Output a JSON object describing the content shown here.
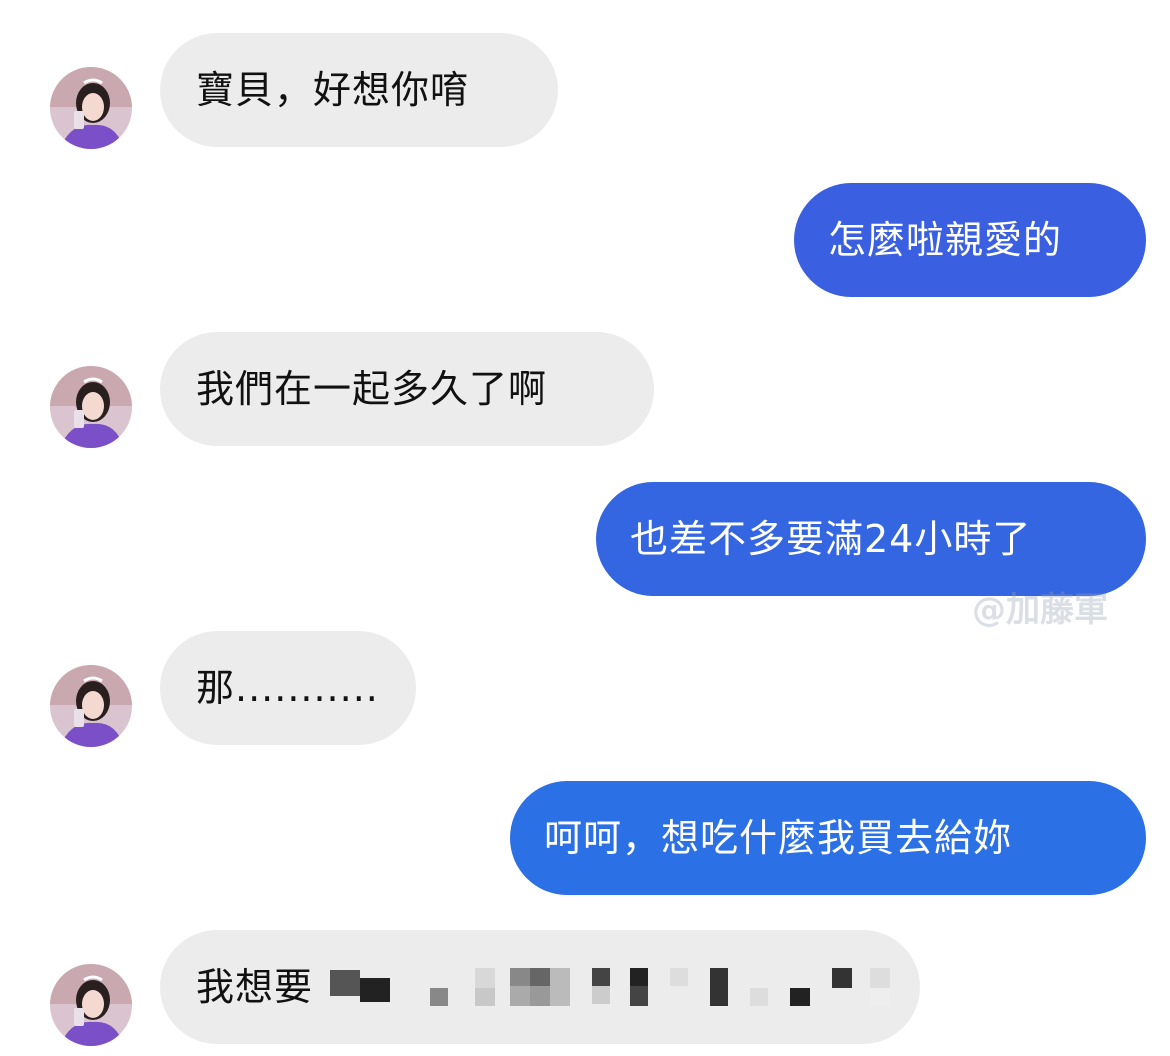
{
  "conversation": {
    "messages": [
      {
        "side": "incoming",
        "text": "寶貝，好想你唷"
      },
      {
        "side": "outgoing",
        "text": "怎麼啦親愛的"
      },
      {
        "side": "incoming",
        "text": "我們在一起多久了啊"
      },
      {
        "side": "outgoing",
        "text": "也差不多要滿24小時了"
      },
      {
        "side": "incoming",
        "text": "那..........."
      },
      {
        "side": "outgoing",
        "text": "呵呵，想吃什麼我買去給妳"
      },
      {
        "side": "incoming",
        "text": "我想要"
      }
    ]
  },
  "watermark": "@加藤軍",
  "colors": {
    "incoming_bubble": "#ececec",
    "outgoing_bubble": "#2e67e6",
    "incoming_text": "#111111",
    "outgoing_text": "#ffffff"
  },
  "icons": {
    "avatar": "contact-avatar-photo"
  }
}
